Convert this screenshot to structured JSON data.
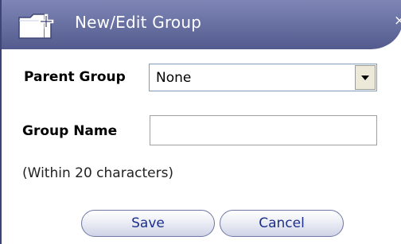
{
  "dialog": {
    "title": "New/Edit Group",
    "title_icon": "folder-plus-icon",
    "close_symbol": "×"
  },
  "form": {
    "parent_group": {
      "label": "Parent Group",
      "selected": "None"
    },
    "group_name": {
      "label": "Group Name",
      "value": ""
    },
    "hint": "(Within 20 characters)"
  },
  "buttons": {
    "save_label": "Save",
    "cancel_label": "Cancel"
  },
  "colors": {
    "titlebar": "#6b73a5",
    "button_text": "#1b2f8c",
    "button_border": "#6f76a4"
  }
}
